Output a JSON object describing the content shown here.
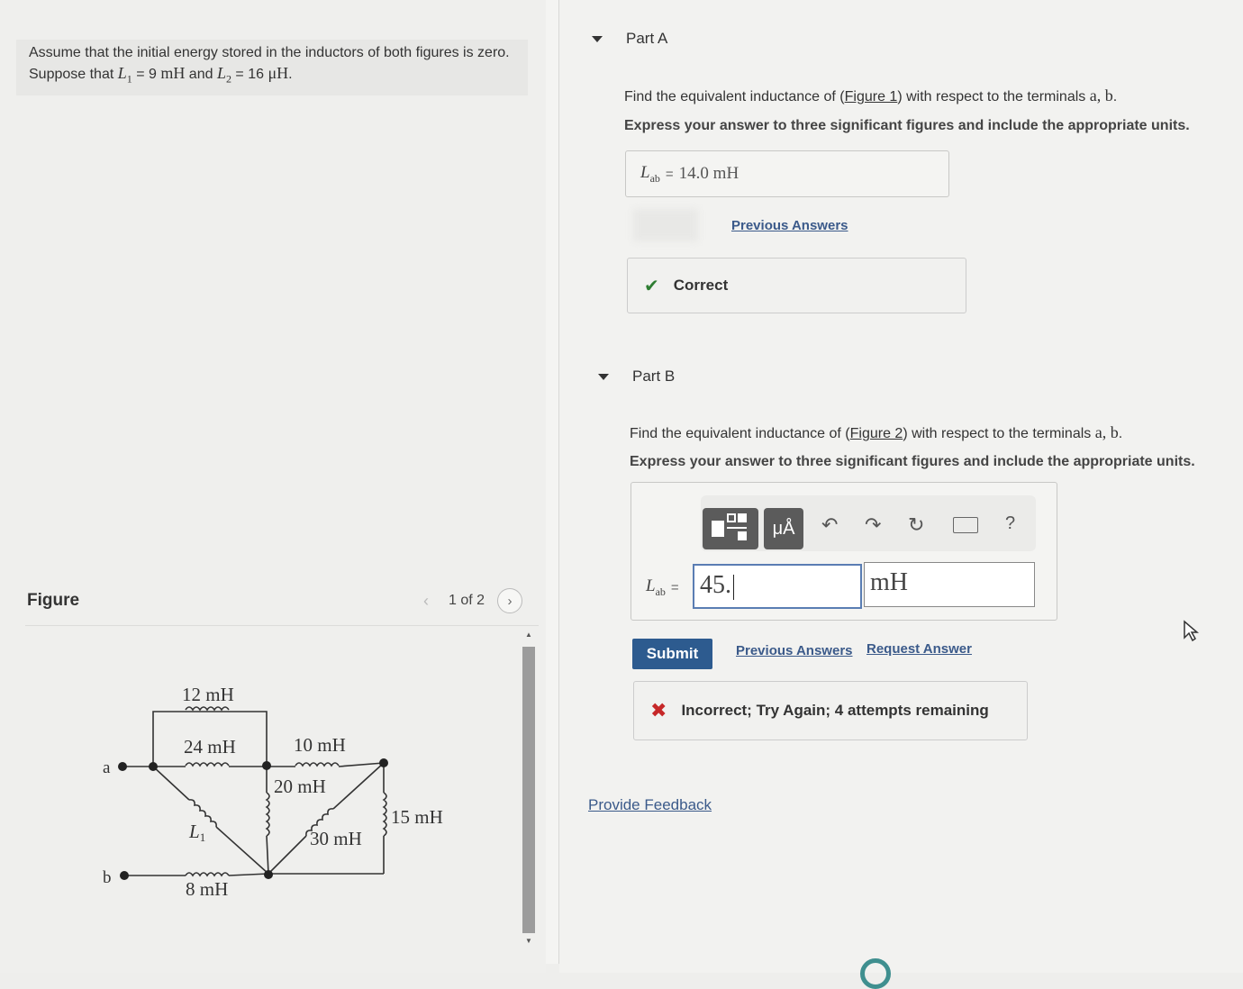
{
  "problem": {
    "text_before": "Assume that the initial energy stored in the inductors of both figures is zero. Suppose that ",
    "l1_sym": "L",
    "l1_sub": "1",
    "l1_val": " = 9  ",
    "l1_unit": "mH",
    "and": " and ",
    "l2_sym": "L",
    "l2_sub": "2",
    "l2_val": " = 16  ",
    "l2_unit": "μH",
    "period": "."
  },
  "figure": {
    "title": "Figure",
    "pager": "1 of 2",
    "prev_icon": "chevron-left-icon",
    "next_icon": "chevron-right-icon",
    "circuit": {
      "terminal_a": "a",
      "terminal_b": "b",
      "l_12": "12 mH",
      "l_24": "24 mH",
      "l_10": "10 mH",
      "l_20": "20 mH",
      "l_30": "30 mH",
      "l_15": "15 mH",
      "l_8": "8 mH",
      "l1_sym": "L",
      "l1_sub": "1"
    }
  },
  "partA": {
    "label": "Part A",
    "prompt_before": "Find the equivalent inductance of (",
    "figure_link": "Figure 1",
    "prompt_after": ") with respect to the terminals ",
    "terminals": "a, b",
    "prompt_end": ".",
    "instructions": "Express your answer to three significant figures and include the appropriate units.",
    "answer_sym": "L",
    "answer_sub": "ab",
    "eq": "=",
    "answer_value": "14.0 mH",
    "previous_answers": "Previous Answers",
    "feedback": "Correct",
    "feedback_icon": "checkmark-icon",
    "accent": "#2e7d32"
  },
  "partB": {
    "label": "Part B",
    "prompt_before": "Find the equivalent inductance of (",
    "figure_link": "Figure 2",
    "prompt_after": ") with respect to the terminals ",
    "terminals": "a, b",
    "prompt_end": ".",
    "instructions": "Express your answer to three significant figures and include the appropriate units.",
    "toolbar": {
      "template_icon": "fraction-template-icon",
      "units_label": "μÅ",
      "undo_icon": "undo-icon",
      "redo_icon": "redo-icon",
      "reset_icon": "reset-icon",
      "keyboard_icon": "keyboard-icon",
      "help_label": "?"
    },
    "answer_sym": "L",
    "answer_sub": "ab",
    "eq": "=",
    "input_value": "45.",
    "unit_value": "mH",
    "submit": "Submit",
    "previous_answers": "Previous Answers",
    "request_answer": "Request Answer",
    "feedback": "Incorrect; Try Again; 4 attempts remaining",
    "feedback_icon": "x-mark-icon",
    "error_color": "#c62828"
  },
  "provide_feedback": "Provide Feedback",
  "colors": {
    "link": "#3b5a8a",
    "submit_bg": "#2d5b8f",
    "input_border": "#5a7db3"
  }
}
